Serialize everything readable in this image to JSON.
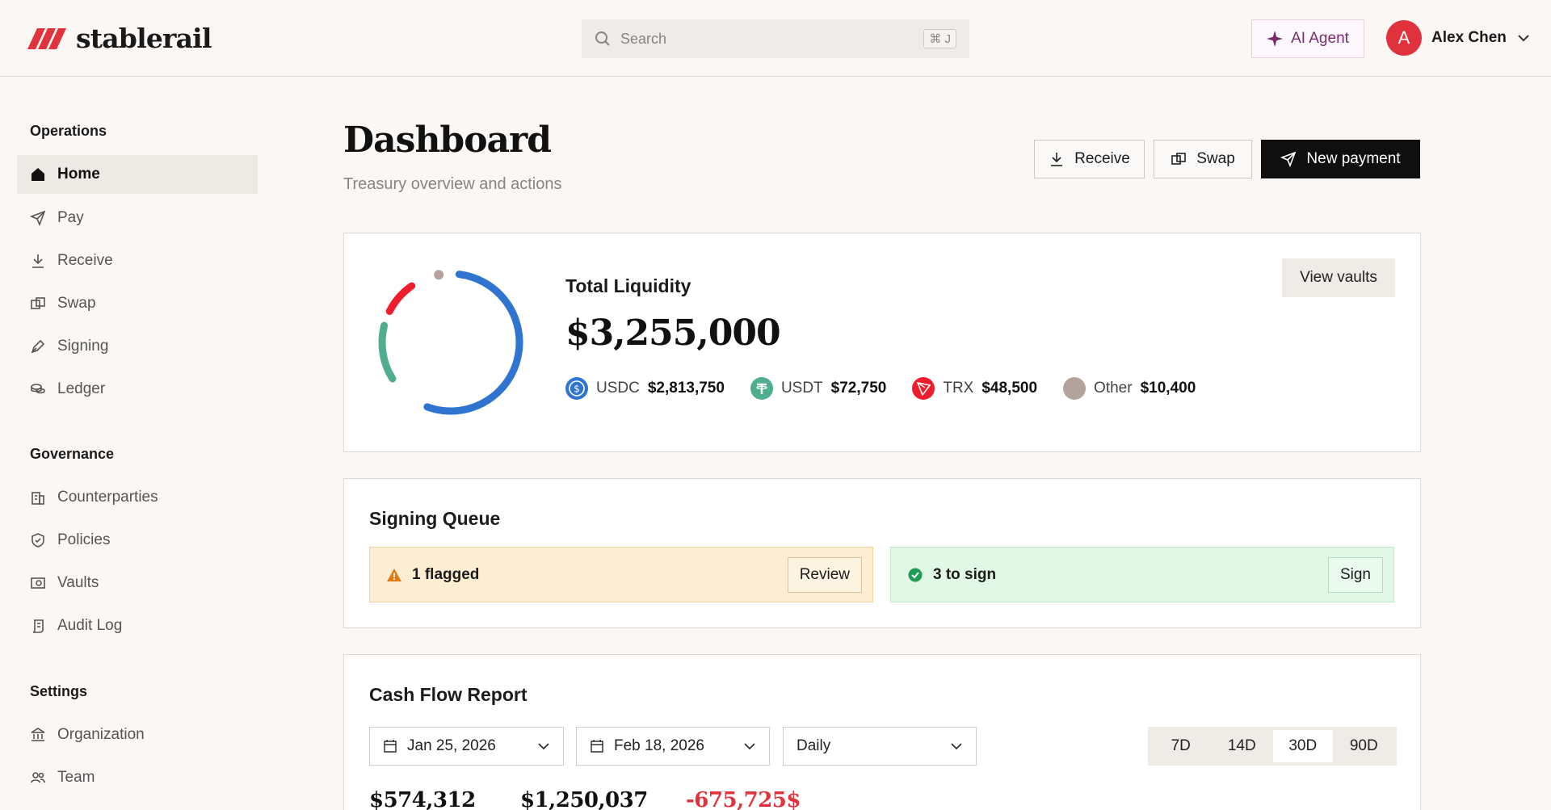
{
  "app": {
    "name": "stablerail"
  },
  "search": {
    "placeholder": "Search",
    "shortcut": "⌘ J"
  },
  "header": {
    "ai_agent_label": "AI Agent",
    "user_initial": "A",
    "user_name": "Alex Chen"
  },
  "sidebar": {
    "sections": [
      {
        "title": "Operations",
        "items": [
          {
            "label": "Home",
            "icon": "home-icon",
            "active": true
          },
          {
            "label": "Pay",
            "icon": "send-icon"
          },
          {
            "label": "Receive",
            "icon": "download-icon"
          },
          {
            "label": "Swap",
            "icon": "swap-icon"
          },
          {
            "label": "Signing",
            "icon": "pen-icon"
          },
          {
            "label": "Ledger",
            "icon": "coins-icon"
          }
        ]
      },
      {
        "title": "Governance",
        "items": [
          {
            "label": "Counterparties",
            "icon": "building-icon"
          },
          {
            "label": "Policies",
            "icon": "shield-check-icon"
          },
          {
            "label": "Vaults",
            "icon": "vault-icon"
          },
          {
            "label": "Audit Log",
            "icon": "scroll-icon"
          }
        ]
      },
      {
        "title": "Settings",
        "items": [
          {
            "label": "Organization",
            "icon": "bank-icon"
          },
          {
            "label": "Team",
            "icon": "users-icon"
          }
        ]
      }
    ]
  },
  "page": {
    "title": "Dashboard",
    "subtitle": "Treasury overview and actions",
    "actions": {
      "receive": "Receive",
      "swap": "Swap",
      "new_payment": "New payment"
    }
  },
  "liquidity": {
    "title": "Total Liquidity",
    "amount": "$3,255,000",
    "view_vaults": "View vaults",
    "assets": [
      {
        "name": "USDC",
        "value": "$2,813,750",
        "color": "#2f74d0"
      },
      {
        "name": "USDT",
        "value": "$72,750",
        "color": "#4fae8e"
      },
      {
        "name": "TRX",
        "value": "$48,500",
        "color": "#ef1c2b"
      },
      {
        "name": "Other",
        "value": "$10,400",
        "color": "#b3a39a"
      }
    ]
  },
  "signing_queue": {
    "title": "Signing Queue",
    "flagged": {
      "label": "1 flagged",
      "action": "Review",
      "color": "#fdeed3"
    },
    "to_sign": {
      "label": "3 to sign",
      "action": "Sign",
      "color": "#e2f8e7"
    }
  },
  "cash_flow": {
    "title": "Cash Flow Report",
    "start_date": "Jan 25, 2026",
    "end_date": "Feb 18, 2026",
    "interval": "Daily",
    "ranges": [
      "7D",
      "14D",
      "30D",
      "90D"
    ],
    "active_range": "30D",
    "metrics": [
      "$574,312",
      "$1,250,037",
      "-675,725$"
    ]
  }
}
